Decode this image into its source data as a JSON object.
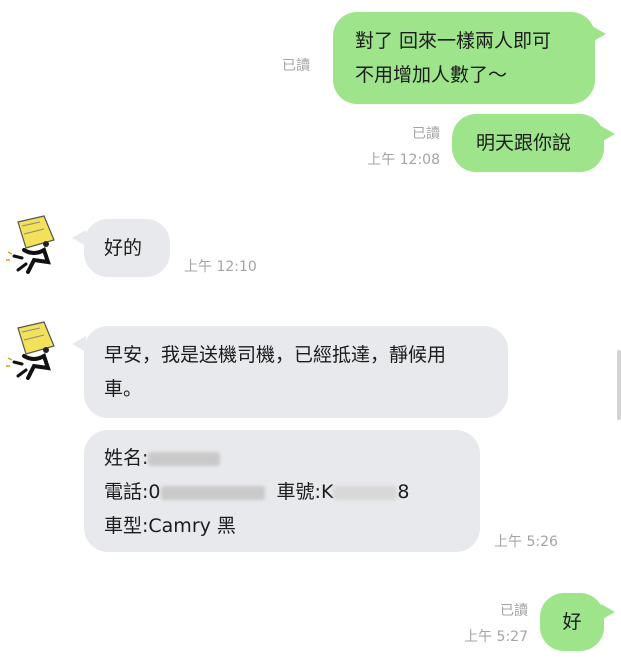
{
  "messages": {
    "m1": {
      "lines": [
        "對了 回來一樣兩人即可",
        "不用增加人數了～"
      ],
      "read": "已讀"
    },
    "m2": {
      "text": "明天跟你說",
      "read": "已讀",
      "time": "上午 12:08"
    },
    "m3": {
      "text": "好的",
      "time": "上午 12:10"
    },
    "m4": {
      "lines": [
        "早安，我是送機司機，已經抵達，靜候用",
        "車。"
      ]
    },
    "m5": {
      "name_label": "姓名:",
      "phone_label": "電話:",
      "phone_visible": "0",
      "plate_label": "車號:",
      "plate_visible_start": "K",
      "plate_visible_end": "8",
      "car_type": "車型:Camry 黑",
      "time": "上午 5:26"
    },
    "m6": {
      "text": "好",
      "read": "已讀",
      "time": "上午 5:27"
    }
  },
  "colors": {
    "outgoing": "#9de48b",
    "incoming": "#e8e9ec",
    "meta": "#a4a4a4"
  },
  "icons": {
    "avatar": "cartoon-runner-avatar"
  }
}
